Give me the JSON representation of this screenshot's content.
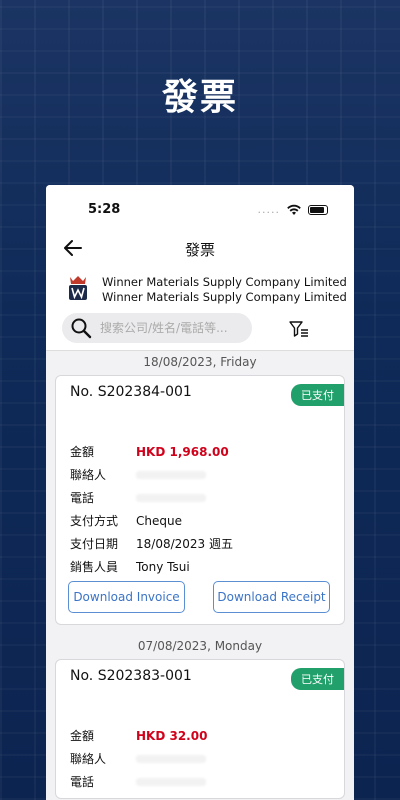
{
  "hero": {
    "title": "發票"
  },
  "status": {
    "time": "5:28",
    "dots": "....."
  },
  "nav": {
    "title": "發票"
  },
  "company": {
    "name_line1": "Winner Materials Supply Company Limited",
    "name_line2": "Winner Materials Supply Company Limited"
  },
  "search": {
    "placeholder": "搜索公司/姓名/電話等..."
  },
  "colors": {
    "badge_paid": "#22a06b",
    "amount": "#d0021b",
    "button_outline": "#5b8fd4"
  },
  "groups": [
    {
      "date": "18/08/2023, Friday",
      "invoice": {
        "number": "No. S202384-001",
        "status": "已支付",
        "rows": [
          {
            "label": "金額",
            "value": "HKD 1,968.00"
          },
          {
            "label": "聯絡人",
            "value": ""
          },
          {
            "label": "電話",
            "value": ""
          },
          {
            "label": "支付方式",
            "value": "Cheque"
          },
          {
            "label": "支付日期",
            "value": "18/08/2023 週五"
          },
          {
            "label": "銷售人員",
            "value": "Tony Tsui"
          }
        ],
        "download_invoice": "Download Invoice",
        "download_receipt": "Download Receipt"
      }
    },
    {
      "date": "07/08/2023, Monday",
      "invoice": {
        "number": "No. S202383-001",
        "status": "已支付",
        "rows": [
          {
            "label": "金額",
            "value": "HKD 32.00"
          },
          {
            "label": "聯絡人",
            "value": ""
          },
          {
            "label": "電話",
            "value": ""
          }
        ]
      }
    }
  ]
}
